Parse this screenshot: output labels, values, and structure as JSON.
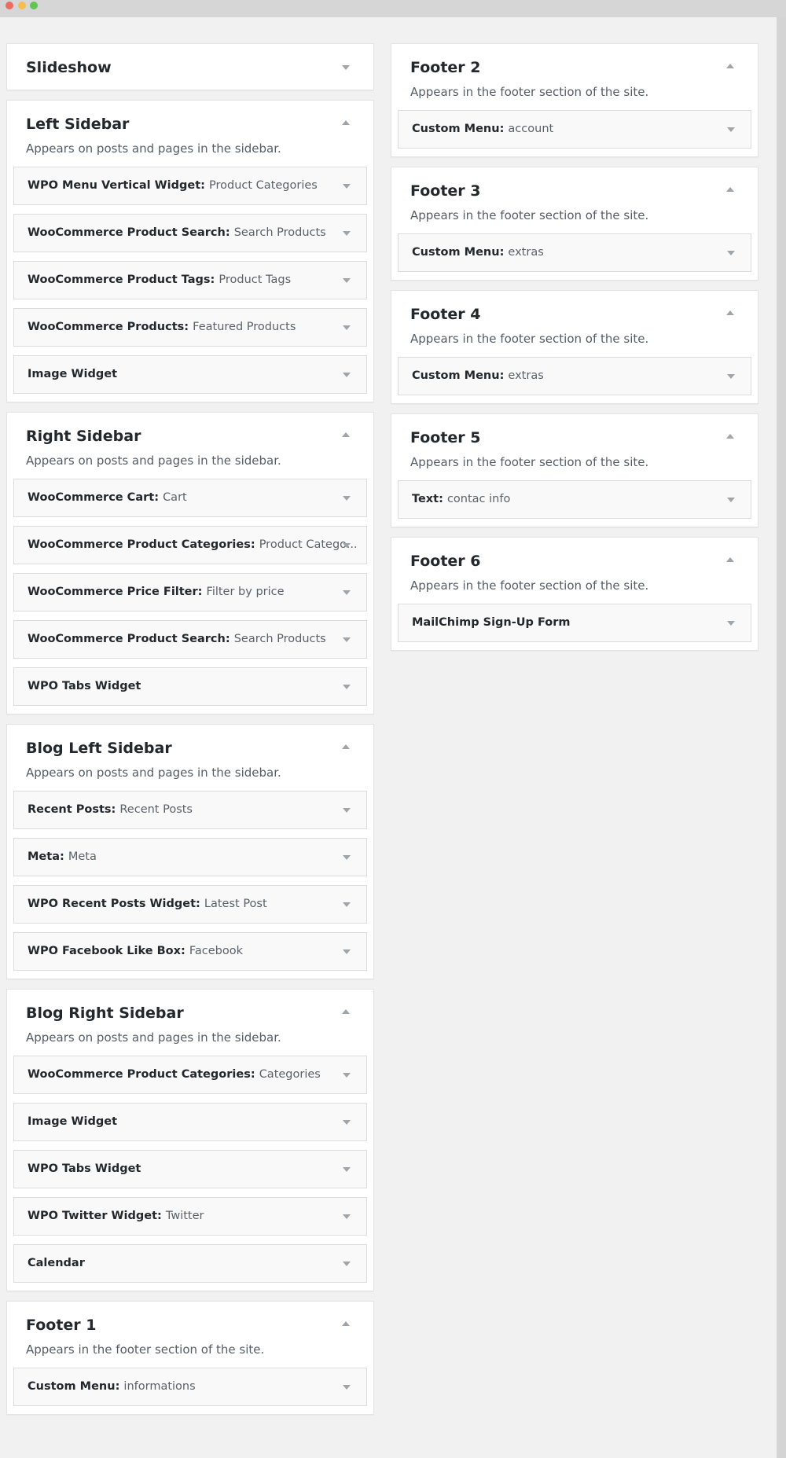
{
  "window": {
    "controls": [
      "close",
      "minimize",
      "maximize"
    ],
    "colors": {
      "close": "#ee6b60",
      "minimize": "#f5be4f",
      "maximize": "#61c454"
    }
  },
  "left_column": [
    {
      "title": "Slideshow",
      "expanded": false,
      "description": "",
      "widgets": []
    },
    {
      "title": "Left Sidebar",
      "expanded": true,
      "description": "Appears on posts and pages in the sidebar.",
      "widgets": [
        {
          "name": "WPO Menu Vertical Widget",
          "subtitle": "Product Categories"
        },
        {
          "name": "WooCommerce Product Search",
          "subtitle": "Search Products"
        },
        {
          "name": "WooCommerce Product Tags",
          "subtitle": "Product Tags"
        },
        {
          "name": "WooCommerce Products",
          "subtitle": "Featured Products"
        },
        {
          "name": "Image Widget",
          "subtitle": ""
        }
      ]
    },
    {
      "title": "Right Sidebar",
      "expanded": true,
      "description": "Appears on posts and pages in the sidebar.",
      "widgets": [
        {
          "name": "WooCommerce Cart",
          "subtitle": "Cart"
        },
        {
          "name": "WooCommerce Product Categories",
          "subtitle": "Product Catego..."
        },
        {
          "name": "WooCommerce Price Filter",
          "subtitle": "Filter by price"
        },
        {
          "name": "WooCommerce Product Search",
          "subtitle": "Search Products"
        },
        {
          "name": "WPO Tabs Widget",
          "subtitle": ""
        }
      ]
    },
    {
      "title": "Blog Left Sidebar",
      "expanded": true,
      "description": "Appears on posts and pages in the sidebar.",
      "widgets": [
        {
          "name": "Recent Posts",
          "subtitle": "Recent Posts"
        },
        {
          "name": "Meta",
          "subtitle": "Meta"
        },
        {
          "name": "WPO Recent Posts Widget",
          "subtitle": "Latest Post"
        },
        {
          "name": "WPO Facebook Like Box",
          "subtitle": "Facebook"
        }
      ]
    },
    {
      "title": "Blog Right Sidebar",
      "expanded": true,
      "description": "Appears on posts and pages in the sidebar.",
      "widgets": [
        {
          "name": "WooCommerce Product Categories",
          "subtitle": "Categories"
        },
        {
          "name": "Image Widget",
          "subtitle": ""
        },
        {
          "name": "WPO Tabs Widget",
          "subtitle": ""
        },
        {
          "name": "WPO Twitter Widget",
          "subtitle": "Twitter"
        },
        {
          "name": "Calendar",
          "subtitle": ""
        }
      ]
    },
    {
      "title": "Footer 1",
      "expanded": true,
      "description": "Appears in the footer section of the site.",
      "widgets": [
        {
          "name": "Custom Menu",
          "subtitle": "informations"
        }
      ]
    }
  ],
  "right_column": [
    {
      "title": "Footer 2",
      "expanded": true,
      "description": "Appears in the footer section of the site.",
      "widgets": [
        {
          "name": "Custom Menu",
          "subtitle": "account"
        }
      ]
    },
    {
      "title": "Footer 3",
      "expanded": true,
      "description": "Appears in the footer section of the site.",
      "widgets": [
        {
          "name": "Custom Menu",
          "subtitle": "extras"
        }
      ]
    },
    {
      "title": "Footer 4",
      "expanded": true,
      "description": "Appears in the footer section of the site.",
      "widgets": [
        {
          "name": "Custom Menu",
          "subtitle": "extras"
        }
      ]
    },
    {
      "title": "Footer 5",
      "expanded": true,
      "description": "Appears in the footer section of the site.",
      "widgets": [
        {
          "name": "Text",
          "subtitle": "contac info"
        }
      ]
    },
    {
      "title": "Footer 6",
      "expanded": true,
      "description": "Appears in the footer section of the site.",
      "widgets": [
        {
          "name": "MailChimp Sign-Up Form",
          "subtitle": ""
        }
      ]
    }
  ],
  "icons": {
    "expanded": "triangle-up-icon",
    "collapsed": "triangle-down-icon",
    "widget_toggle": "triangle-down-icon"
  }
}
